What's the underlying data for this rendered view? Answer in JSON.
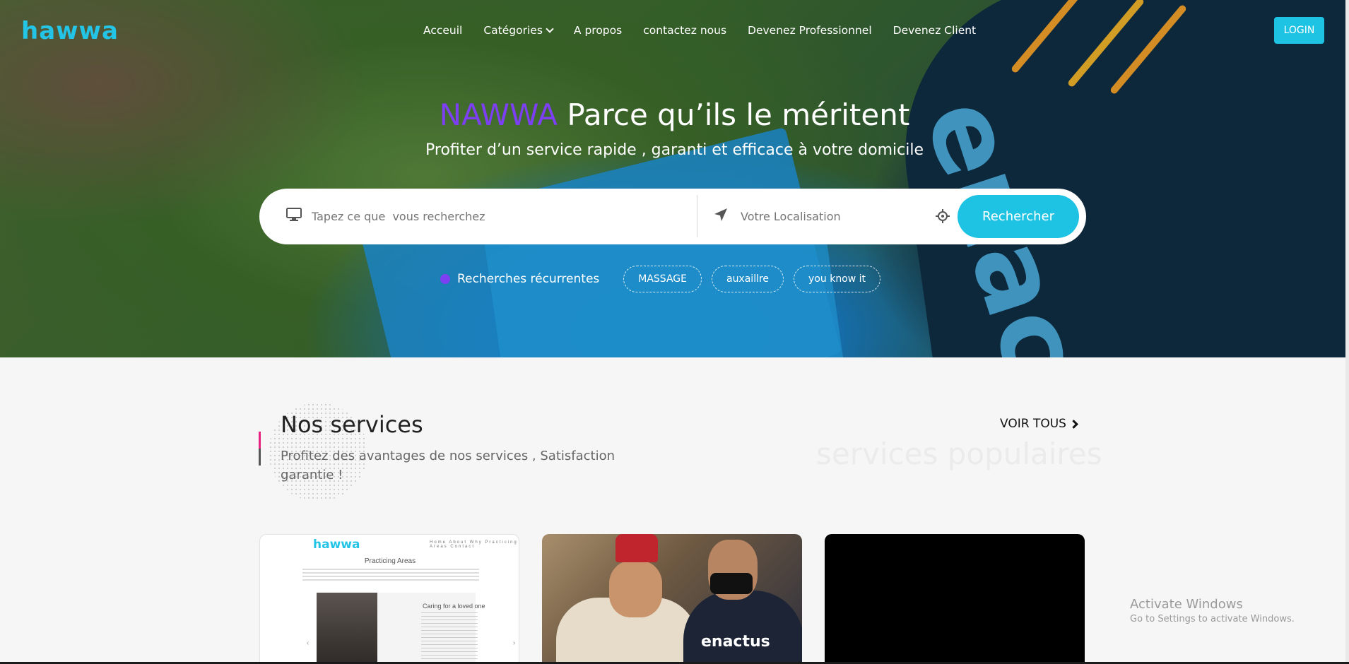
{
  "brand": {
    "logo": "hawwa"
  },
  "nav": {
    "items": [
      {
        "label": "Acceuil"
      },
      {
        "label": "Catégories",
        "has_dropdown": true
      },
      {
        "label": "A propos"
      },
      {
        "label": "contactez nous"
      },
      {
        "label": "Devenez Professionnel"
      },
      {
        "label": "Devenez Client"
      }
    ],
    "login_label": "LOGIN"
  },
  "hero": {
    "brand_word": "NAWWA",
    "tagline": "Parce qu’ils le méritent",
    "subtitle": "Profiter d’un service rapide , garanti et efficace à votre domicile"
  },
  "search": {
    "what_placeholder": "Tapez ce que  vous recherchez",
    "where_placeholder": "Votre Localisation",
    "button_label": "Rechercher"
  },
  "recent": {
    "label": "Recherches récurrentes",
    "chips": [
      "MASSAGE",
      "auxaillre",
      "you know it"
    ]
  },
  "services": {
    "title": "Nos services",
    "subtitle": "Profitez des avantages de nos services , Satisfaction garantie !",
    "see_all": "VOIR TOUS",
    "watermark": "services populaires"
  },
  "cards": {
    "card1": {
      "logo": "hawwa",
      "nav": "Home About Why Practicing Areas Contact",
      "title": "Practicing Areas",
      "caption": "Caring for a loved one"
    },
    "card2": {
      "shirt_text": "enactus"
    }
  },
  "windows": {
    "title": "Activate Windows",
    "subtitle": "Go to Settings to activate Windows."
  },
  "colors": {
    "accent": "#1ec3e3",
    "purple": "#7d3ff2",
    "pink": "#e6217f"
  }
}
